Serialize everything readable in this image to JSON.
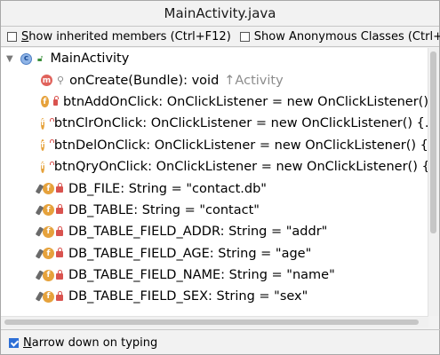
{
  "window": {
    "title": "MainActivity.java"
  },
  "options": {
    "inherited": {
      "label_u": "S",
      "label": "how inherited members (Ctrl+F12)",
      "checked": false
    },
    "anonymous": {
      "label_u": "",
      "label": "Show Anonymous Classes (Ctrl+I)",
      "checked": false
    }
  },
  "tree": {
    "root": {
      "label": "MainActivity",
      "icon": "class-icon"
    },
    "items": [
      {
        "text": "onCreate(Bundle): void",
        "extra": "↑Activity",
        "icon": "method-icon",
        "icon_letter": "m"
      },
      {
        "text": "btnAddOnClick: OnClickListener = new OnClickListener()",
        "icon": "field-icon",
        "icon_letter": "f"
      },
      {
        "text": "btnClrOnClick: OnClickListener = new OnClickListener() {...",
        "icon": "field-icon",
        "icon_letter": "f"
      },
      {
        "text": "btnDelOnClick: OnClickListener = new OnClickListener() {...",
        "icon": "field-icon",
        "icon_letter": "f"
      },
      {
        "text": "btnQryOnClick: OnClickListener = new OnClickListener() {",
        "icon": "field-icon",
        "icon_letter": "f"
      },
      {
        "text": "DB_FILE: String = \"contact.db\"",
        "icon": "static-field-icon",
        "icon_letter": "f"
      },
      {
        "text": "DB_TABLE: String = \"contact\"",
        "icon": "static-field-icon",
        "icon_letter": "f"
      },
      {
        "text": "DB_TABLE_FIELD_ADDR: String = \"addr\"",
        "icon": "static-field-icon",
        "icon_letter": "f"
      },
      {
        "text": "DB_TABLE_FIELD_AGE: String = \"age\"",
        "icon": "static-field-icon",
        "icon_letter": "f"
      },
      {
        "text": "DB_TABLE_FIELD_NAME: String = \"name\"",
        "icon": "static-field-icon",
        "icon_letter": "f"
      },
      {
        "text": "DB_TABLE_FIELD_SEX: String = \"sex\"",
        "icon": "static-field-icon",
        "icon_letter": "f"
      }
    ]
  },
  "bottom": {
    "narrow": {
      "label_u": "N",
      "label": "arrow down on typing",
      "checked": true
    }
  },
  "colors": {
    "accent": "#2d6fd6",
    "field_icon": "#e6a23c",
    "method_icon": "#e0625b",
    "class_icon": "#8fb4e6",
    "private_lock": "#d9534f"
  }
}
